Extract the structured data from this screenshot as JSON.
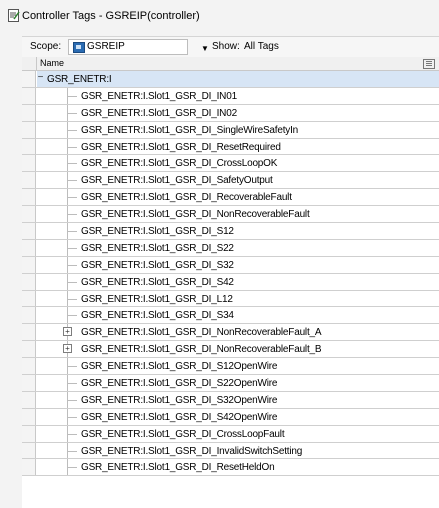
{
  "window": {
    "title": "Controller Tags - GSREIP(controller)"
  },
  "toolbar": {
    "scope_label": "Scope:",
    "scope_value": "GSREIP",
    "show_label": "Show:",
    "show_value": "All Tags"
  },
  "grid": {
    "column_name": "Name",
    "rows": [
      {
        "label": "GSR_ENETR:I",
        "expander": "−",
        "group": true
      },
      {
        "label": "GSR_ENETR:I.Slot1_GSR_DI_IN01",
        "expander": ""
      },
      {
        "label": "GSR_ENETR:I.Slot1_GSR_DI_IN02",
        "expander": ""
      },
      {
        "label": "GSR_ENETR:I.Slot1_GSR_DI_SingleWireSafetyIn",
        "expander": ""
      },
      {
        "label": "GSR_ENETR:I.Slot1_GSR_DI_ResetRequired",
        "expander": ""
      },
      {
        "label": "GSR_ENETR:I.Slot1_GSR_DI_CrossLoopOK",
        "expander": ""
      },
      {
        "label": "GSR_ENETR:I.Slot1_GSR_DI_SafetyOutput",
        "expander": ""
      },
      {
        "label": "GSR_ENETR:I.Slot1_GSR_DI_RecoverableFault",
        "expander": ""
      },
      {
        "label": "GSR_ENETR:I.Slot1_GSR_DI_NonRecoverableFault",
        "expander": ""
      },
      {
        "label": "GSR_ENETR:I.Slot1_GSR_DI_S12",
        "expander": ""
      },
      {
        "label": "GSR_ENETR:I.Slot1_GSR_DI_S22",
        "expander": ""
      },
      {
        "label": "GSR_ENETR:I.Slot1_GSR_DI_S32",
        "expander": ""
      },
      {
        "label": "GSR_ENETR:I.Slot1_GSR_DI_S42",
        "expander": ""
      },
      {
        "label": "GSR_ENETR:I.Slot1_GSR_DI_L12",
        "expander": ""
      },
      {
        "label": "GSR_ENETR:I.Slot1_GSR_DI_S34",
        "expander": ""
      },
      {
        "label": "GSR_ENETR:I.Slot1_GSR_DI_NonRecoverableFault_A",
        "expander": "+"
      },
      {
        "label": "GSR_ENETR:I.Slot1_GSR_DI_NonRecoverableFault_B",
        "expander": "+"
      },
      {
        "label": "GSR_ENETR:I.Slot1_GSR_DI_S12OpenWire",
        "expander": ""
      },
      {
        "label": "GSR_ENETR:I.Slot1_GSR_DI_S22OpenWire",
        "expander": ""
      },
      {
        "label": "GSR_ENETR:I.Slot1_GSR_DI_S32OpenWire",
        "expander": ""
      },
      {
        "label": "GSR_ENETR:I.Slot1_GSR_DI_S42OpenWire",
        "expander": ""
      },
      {
        "label": "GSR_ENETR:I.Slot1_GSR_DI_CrossLoopFault",
        "expander": ""
      },
      {
        "label": "GSR_ENETR:I.Slot1_GSR_DI_InvalidSwitchSetting",
        "expander": ""
      },
      {
        "label": "GSR_ENETR:I.Slot1_GSR_DI_ResetHeldOn",
        "expander": ""
      }
    ]
  },
  "colors": {
    "group_row_bg": "#d7e5f5",
    "grid_line": "#cfcfcf"
  },
  "icons": {
    "title": "tag-editor-icon",
    "scope": "controller-icon",
    "dropdown": "chevron-down-icon",
    "column_options": "column-options-icon"
  }
}
